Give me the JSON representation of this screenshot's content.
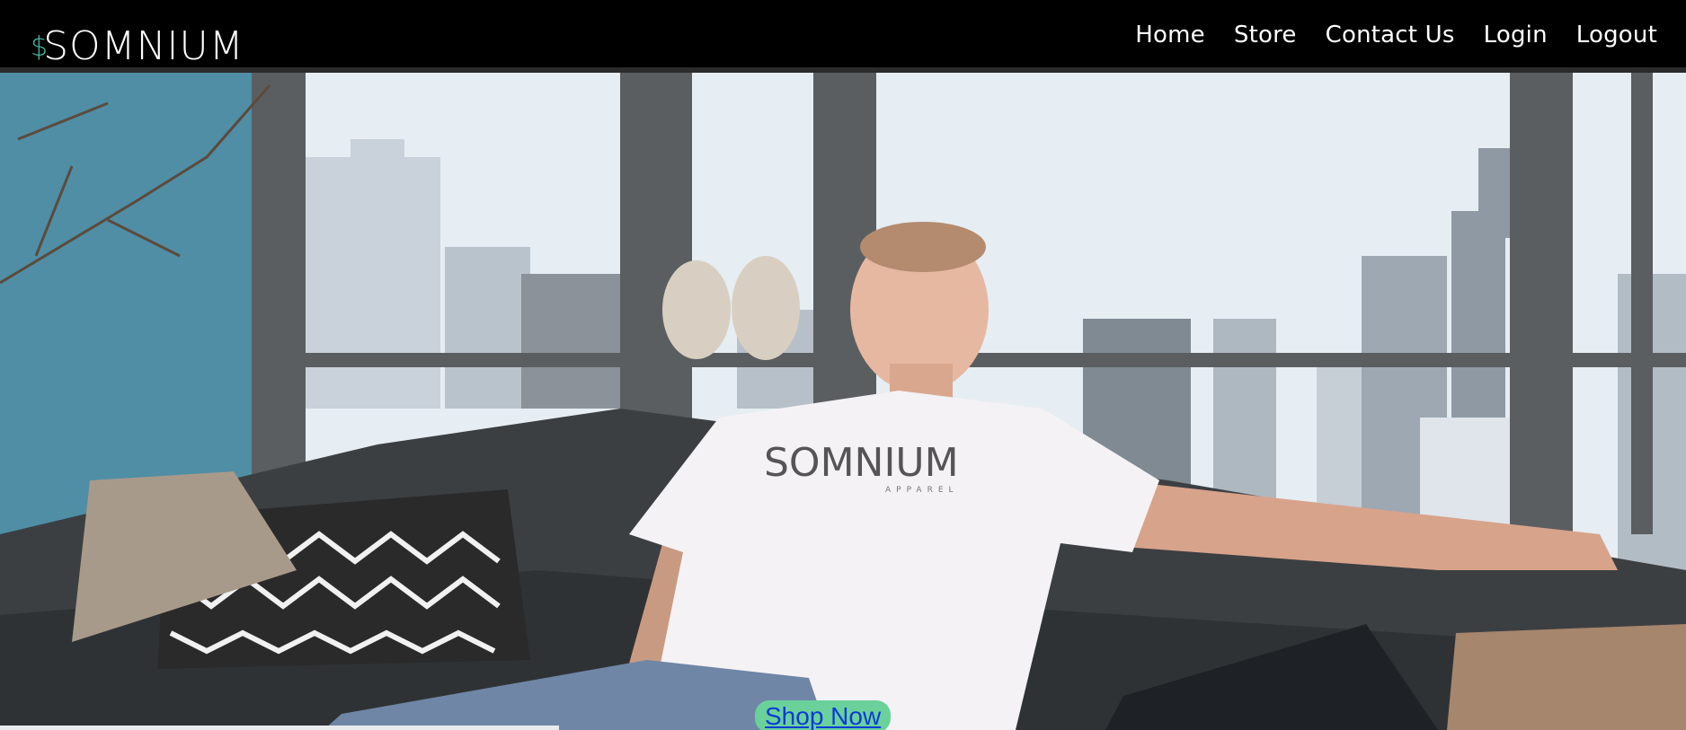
{
  "brand": {
    "logo_text": "SOMNIUM",
    "logo_symbol": "$"
  },
  "nav": {
    "items": [
      {
        "label": "Home"
      },
      {
        "label": "Store"
      },
      {
        "label": "Contact Us"
      },
      {
        "label": "Login"
      },
      {
        "label": "Logout"
      }
    ]
  },
  "hero": {
    "shirt_print": "SOMNIUM",
    "shirt_subprint": "APPAREL",
    "cta_label": "Shop Now"
  },
  "colors": {
    "header_bg": "#000000",
    "cta_bg": "#6bd19b",
    "cta_text": "#0b3bd9",
    "accent": "#41b8a0"
  }
}
